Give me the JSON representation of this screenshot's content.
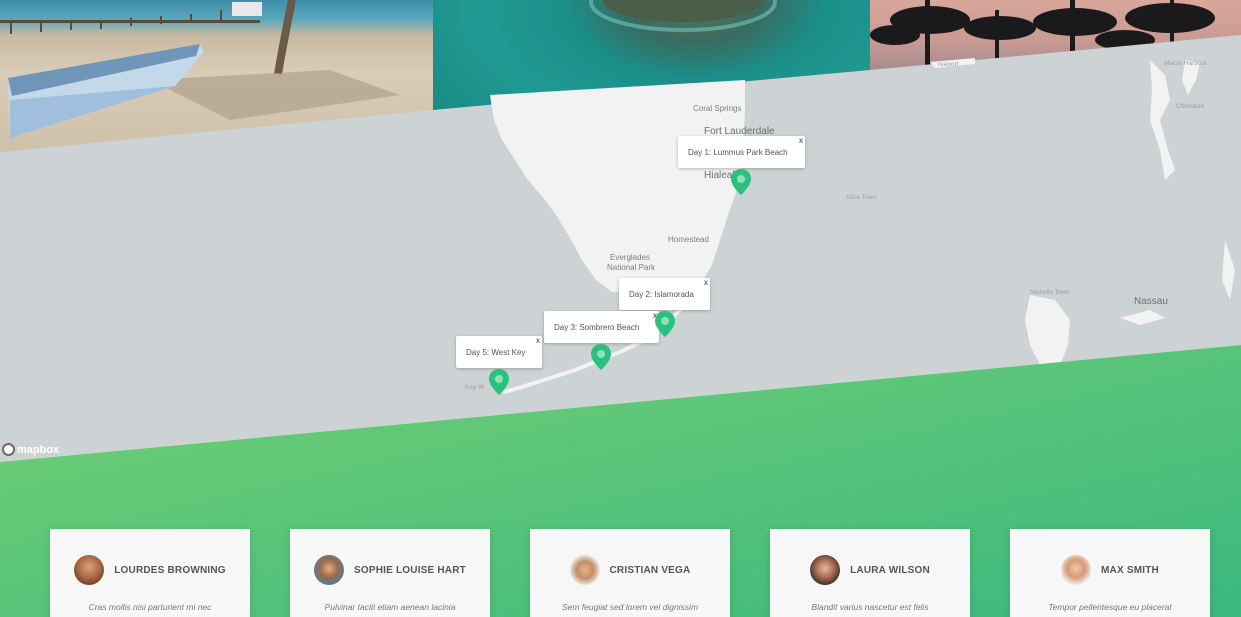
{
  "map": {
    "popups": [
      {
        "label": "Day 1: Lummus Park Beach",
        "close": "x"
      },
      {
        "label": "Day 2: Islamorada",
        "close": "x"
      },
      {
        "label": "Day 3: Sombrero Beach",
        "close": "x"
      },
      {
        "label": "Day 5: West Key",
        "close": "x"
      }
    ],
    "places": {
      "coral_springs": "Coral Springs",
      "fort_lauderdale": "Fort Lauderdale",
      "hialeah": "Hialeah",
      "homestead": "Homestead",
      "everglades": "Everglades",
      "national_park": "National Park",
      "nassau": "Nassau",
      "key_west": "Key W",
      "freeport": "reeport",
      "marsh_harbour": "Marsh Harbour",
      "cherokee": "Cherokee",
      "alice_town": "Alice Town",
      "nicholls_town": "Nicholls Town"
    },
    "attribution": "mapbox",
    "colors": {
      "water": "#cdd3d5",
      "land": "#f2f2f2",
      "marker": "#2cc07f"
    }
  },
  "testimonials": [
    {
      "name": "LOURDES BROWNING",
      "quote": "Cras mollis nisi parturient mi nec"
    },
    {
      "name": "SOPHIE LOUISE HART",
      "quote": "Pulvinar taciti etiam aenean lacinia"
    },
    {
      "name": "CRISTIAN VEGA",
      "quote": "Sem feugiat sed lorem vel dignissim"
    },
    {
      "name": "LAURA WILSON",
      "quote": "Blandit varius nascetur est felis"
    },
    {
      "name": "MAX SMITH",
      "quote": "Tempor pellentesque eu placerat"
    }
  ],
  "colors": {
    "gradient_start": "#6fcf6e",
    "gradient_end": "#3bb87f",
    "card_bg": "#f7f7f7"
  }
}
